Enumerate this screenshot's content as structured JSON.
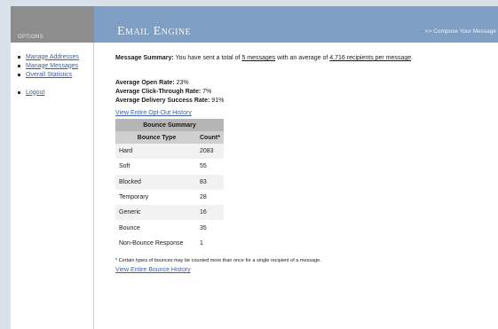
{
  "sidebar": {
    "options_label": "OPTIONS",
    "items": [
      {
        "label": "Manage Addresses"
      },
      {
        "label": "Manage Messages"
      },
      {
        "label": "Overall Statistics"
      },
      {
        "label": "Logout"
      }
    ]
  },
  "header": {
    "title": "Email Engine",
    "compose_link": ">> Compose Your Message"
  },
  "summary": {
    "label": "Message Summary:",
    "text1": " You have sent a total of ",
    "messages_link": "5 messages",
    "text2": " with an average of ",
    "recipients_link": "4,716 recipients per message",
    "text3": "."
  },
  "rates": {
    "open_label": "Average Open Rate:",
    "open_value": " 23%",
    "click_label": "Average Click-Through Rate:",
    "click_value": " 7%",
    "delivery_label": "Average Delivery Success Rate:",
    "delivery_value": " 91%"
  },
  "optout_link": "View Entire Opt-Out History",
  "bounce_summary": {
    "title": "Bounce Summary",
    "columns": [
      "Bounce Type",
      "Count*"
    ],
    "rows": [
      {
        "type": "Hard",
        "count": "2083"
      },
      {
        "type": "Soft",
        "count": "55"
      },
      {
        "type": "Blocked",
        "count": "83"
      },
      {
        "type": "Temporary",
        "count": "28"
      },
      {
        "type": "Generic",
        "count": "16"
      },
      {
        "type": "Bounce",
        "count": "35"
      },
      {
        "type": "Non-Bounce Response",
        "count": "1"
      }
    ],
    "footnote": "* Certain types of bounces may be counted more than once for a single recipient of a message.",
    "history_link": "View Entire Bounce History"
  }
}
